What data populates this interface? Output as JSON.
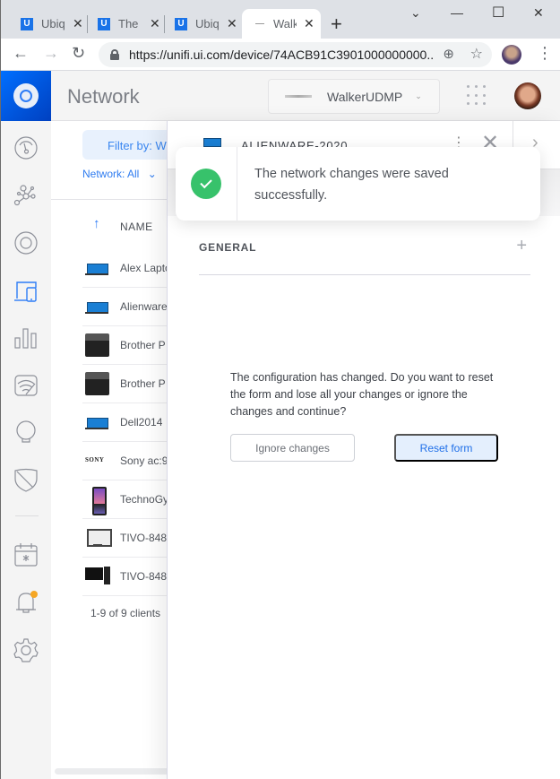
{
  "browser": {
    "tabs": [
      {
        "favicon": "U",
        "title": "Ubiquiti"
      },
      {
        "favicon": "U",
        "title": "The"
      },
      {
        "favicon": "U",
        "title": "Ubiquiti"
      },
      {
        "favicon": "device-icon",
        "title": "WalkerUDMP",
        "active": true
      }
    ],
    "new_tab": "+",
    "window_controls": {
      "tabsearch": "⌄",
      "minimize": "—",
      "maximize": "☐",
      "close": "✕"
    },
    "nav": {
      "back": "←",
      "forward": "→",
      "reload": "↻"
    },
    "url": "https://unifi.ui.com/device/74ACB91C3901000000000...",
    "zoom_icon": "⊕",
    "bookmark_icon": "☆",
    "menu_icon": "⋮"
  },
  "header": {
    "app_title": "Network",
    "device_selector": "WalkerUDMP",
    "chevron": "⌄"
  },
  "clients": {
    "filter_label": "Filter by: W",
    "network_filter": "Network: All",
    "network_chevron": "⌄",
    "sort_arrow": "↑",
    "column_name": "NAME",
    "rows": [
      {
        "name": "Alex Laptop",
        "type": "laptop"
      },
      {
        "name": "Alienware",
        "type": "laptop"
      },
      {
        "name": "Brother P",
        "type": "printer"
      },
      {
        "name": "Brother P",
        "type": "printer"
      },
      {
        "name": "Dell2014",
        "type": "laptop"
      },
      {
        "name": "Sony ac:9",
        "type": "sony"
      },
      {
        "name": "TechnoGym",
        "type": "phone"
      },
      {
        "name": "TIVO-848",
        "type": "tivo"
      },
      {
        "name": "TIVO-848",
        "type": "desktop"
      }
    ],
    "count": "1-9 of 9 clients"
  },
  "panel": {
    "title": "ALIENWARE-2020",
    "more": "⋮",
    "close": "✕",
    "next": "›",
    "section_label": "GENERAL",
    "section_expand": "+",
    "confirm_message": "The configuration has changed. Do you want to reset the form and lose all your changes or ignore the changes and continue?",
    "ignore_button": "Ignore changes",
    "reset_button": "Reset form"
  },
  "toast": {
    "message": "The network changes were saved successfully.",
    "status": "success",
    "color": "#37c26b"
  },
  "colors": {
    "accent": "#2d7cf6",
    "notification_dot": "#f5a623"
  }
}
